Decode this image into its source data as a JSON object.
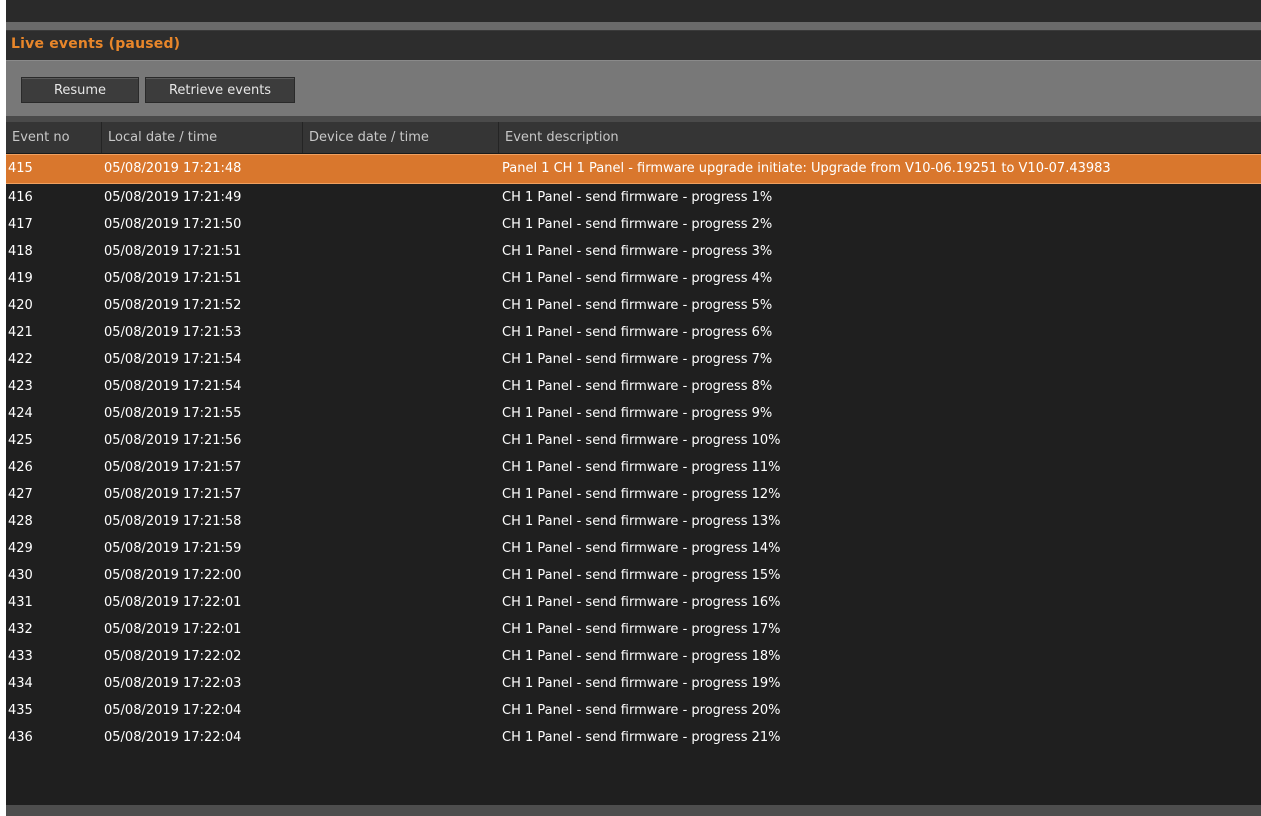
{
  "title": "Live events (paused)",
  "toolbar": {
    "resume_label": "Resume",
    "retrieve_label": "Retrieve events"
  },
  "columns": [
    "Event no",
    "Local date / time",
    "Device date / time",
    "Event description"
  ],
  "rows": [
    {
      "no": "415",
      "local": "05/08/2019 17:21:48",
      "device": "",
      "desc": "Panel 1 CH 1 Panel - firmware upgrade initiate: Upgrade from V10-06.19251 to V10-07.43983",
      "selected": true
    },
    {
      "no": "416",
      "local": "05/08/2019 17:21:49",
      "device": "",
      "desc": "CH 1 Panel - send firmware - progress 1%"
    },
    {
      "no": "417",
      "local": "05/08/2019 17:21:50",
      "device": "",
      "desc": "CH 1 Panel - send firmware - progress 2%"
    },
    {
      "no": "418",
      "local": "05/08/2019 17:21:51",
      "device": "",
      "desc": "CH 1 Panel - send firmware - progress 3%"
    },
    {
      "no": "419",
      "local": "05/08/2019 17:21:51",
      "device": "",
      "desc": "CH 1 Panel - send firmware - progress 4%"
    },
    {
      "no": "420",
      "local": "05/08/2019 17:21:52",
      "device": "",
      "desc": "CH 1 Panel - send firmware - progress 5%"
    },
    {
      "no": "421",
      "local": "05/08/2019 17:21:53",
      "device": "",
      "desc": "CH 1 Panel - send firmware - progress 6%"
    },
    {
      "no": "422",
      "local": "05/08/2019 17:21:54",
      "device": "",
      "desc": "CH 1 Panel - send firmware - progress 7%"
    },
    {
      "no": "423",
      "local": "05/08/2019 17:21:54",
      "device": "",
      "desc": "CH 1 Panel - send firmware - progress 8%"
    },
    {
      "no": "424",
      "local": "05/08/2019 17:21:55",
      "device": "",
      "desc": "CH 1 Panel - send firmware - progress 9%"
    },
    {
      "no": "425",
      "local": "05/08/2019 17:21:56",
      "device": "",
      "desc": "CH 1 Panel - send firmware - progress 10%"
    },
    {
      "no": "426",
      "local": "05/08/2019 17:21:57",
      "device": "",
      "desc": "CH 1 Panel - send firmware - progress 11%"
    },
    {
      "no": "427",
      "local": "05/08/2019 17:21:57",
      "device": "",
      "desc": "CH 1 Panel - send firmware - progress 12%"
    },
    {
      "no": "428",
      "local": "05/08/2019 17:21:58",
      "device": "",
      "desc": "CH 1 Panel - send firmware - progress 13%"
    },
    {
      "no": "429",
      "local": "05/08/2019 17:21:59",
      "device": "",
      "desc": "CH 1 Panel - send firmware - progress 14%"
    },
    {
      "no": "430",
      "local": "05/08/2019 17:22:00",
      "device": "",
      "desc": "CH 1 Panel - send firmware - progress 15%"
    },
    {
      "no": "431",
      "local": "05/08/2019 17:22:01",
      "device": "",
      "desc": "CH 1 Panel - send firmware - progress 16%"
    },
    {
      "no": "432",
      "local": "05/08/2019 17:22:01",
      "device": "",
      "desc": "CH 1 Panel - send firmware - progress 17%"
    },
    {
      "no": "433",
      "local": "05/08/2019 17:22:02",
      "device": "",
      "desc": "CH 1 Panel - send firmware - progress 18%"
    },
    {
      "no": "434",
      "local": "05/08/2019 17:22:03",
      "device": "",
      "desc": "CH 1 Panel - send firmware - progress 19%"
    },
    {
      "no": "435",
      "local": "05/08/2019 17:22:04",
      "device": "",
      "desc": "CH 1 Panel - send firmware - progress 20%"
    },
    {
      "no": "436",
      "local": "05/08/2019 17:22:04",
      "device": "",
      "desc": "CH 1 Panel - send firmware - progress 21%"
    }
  ],
  "colors": {
    "accent": "#e8862a",
    "selected_row": "#d9772d",
    "background": "#1f1f1f"
  }
}
